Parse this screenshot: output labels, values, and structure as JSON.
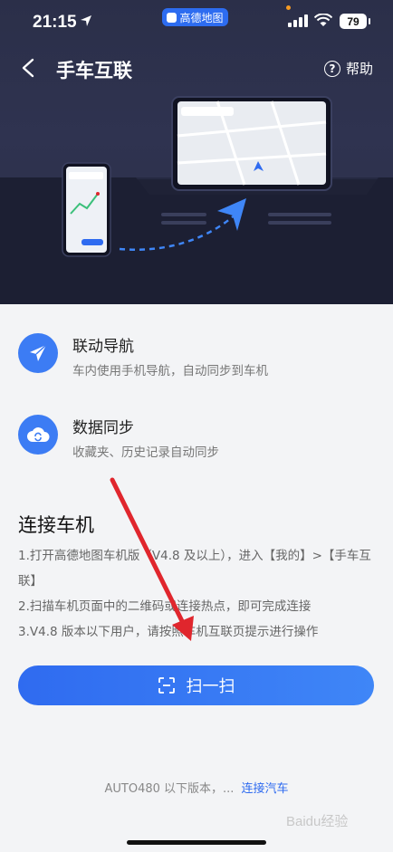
{
  "status_bar": {
    "time": "21:15",
    "app_pill_label": "高德地图",
    "battery": "79"
  },
  "nav": {
    "title": "手车互联",
    "help_label": "帮助"
  },
  "features": [
    {
      "icon": "paper-plane-icon",
      "title": "联动导航",
      "desc": "车内使用手机导航，自动同步到车机"
    },
    {
      "icon": "cloud-sync-icon",
      "title": "数据同步",
      "desc": "收藏夹、历史记录自动同步"
    }
  ],
  "connect": {
    "title": "连接车机",
    "steps": [
      "1.打开高德地图车机版（V4.8 及以上），进入【我的】>【手车互联】",
      "2.扫描车机页面中的二维码或连接热点，即可完成连接",
      "3.V4.8 版本以下用户，请按照车机互联页提示进行操作"
    ]
  },
  "scan_button_label": "扫一扫",
  "footer": {
    "text": "AUTO480 以下版本，...",
    "link": "连接汽车"
  },
  "watermark": "Baidu经验",
  "colors": {
    "accent": "#2f6bf0",
    "hero_bg": "#2b2f49",
    "annotation_arrow": "#e0262d"
  }
}
